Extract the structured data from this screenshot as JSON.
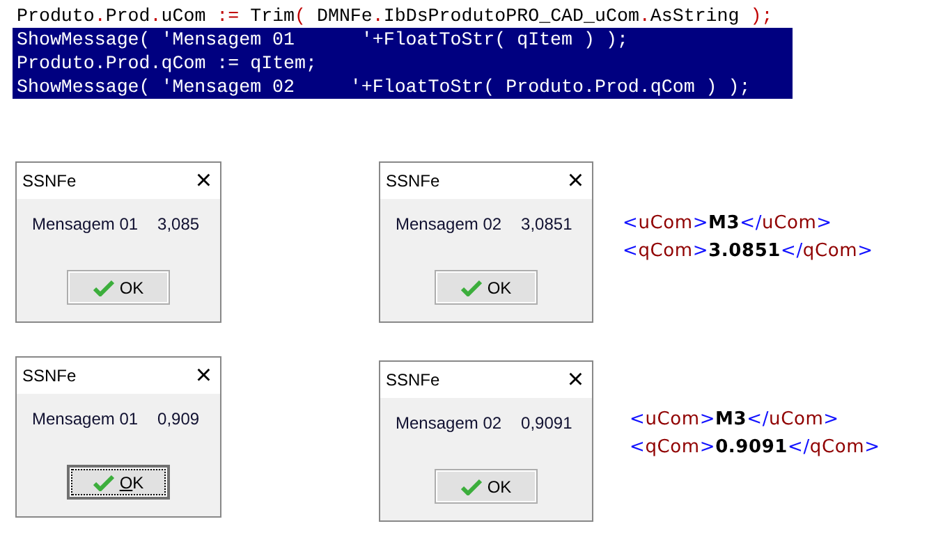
{
  "code_lines": [
    {
      "text": "Produto.Prod.uCom := Trim( DMNFe.IbDsProdutoPRO_CAD_uCom.AsString );",
      "selected": false
    },
    {
      "text": "ShowMessage( 'Mensagem 01      '+FloatToStr( qItem ) );",
      "selected": true
    },
    {
      "text": "Produto.Prod.qCom := qItem;",
      "selected": true
    },
    {
      "text": "ShowMessage( 'Mensagem 02     '+FloatToStr( Produto.Prod.qCom ) );",
      "selected": true
    }
  ],
  "dialogs": [
    {
      "title": "SSNFe",
      "close": "×",
      "label": "Mensagem 01",
      "value": "3,085",
      "button": "OK",
      "focused": false
    },
    {
      "title": "SSNFe",
      "close": "×",
      "label": "Mensagem 02",
      "value": "3,0851",
      "button": "OK",
      "focused": false
    },
    {
      "title": "SSNFe",
      "close": "×",
      "label": "Mensagem 01",
      "value": "0,909",
      "button": "OK",
      "focused": true
    },
    {
      "title": "SSNFe",
      "close": "×",
      "label": "Mensagem 02",
      "value": "0,9091",
      "button": "OK",
      "focused": false
    }
  ],
  "xml_snippets": [
    {
      "lines": [
        {
          "open": "<uCom>",
          "value": "M3",
          "close": "</uCom>"
        },
        {
          "open": "<qCom>",
          "value": "3.0851",
          "close": "</qCom>"
        }
      ]
    },
    {
      "lines": [
        {
          "open": "<uCom>",
          "value": "M3",
          "close": "</uCom>"
        },
        {
          "open": "<qCom>",
          "value": "0.9091",
          "close": "</qCom>"
        }
      ]
    }
  ]
}
